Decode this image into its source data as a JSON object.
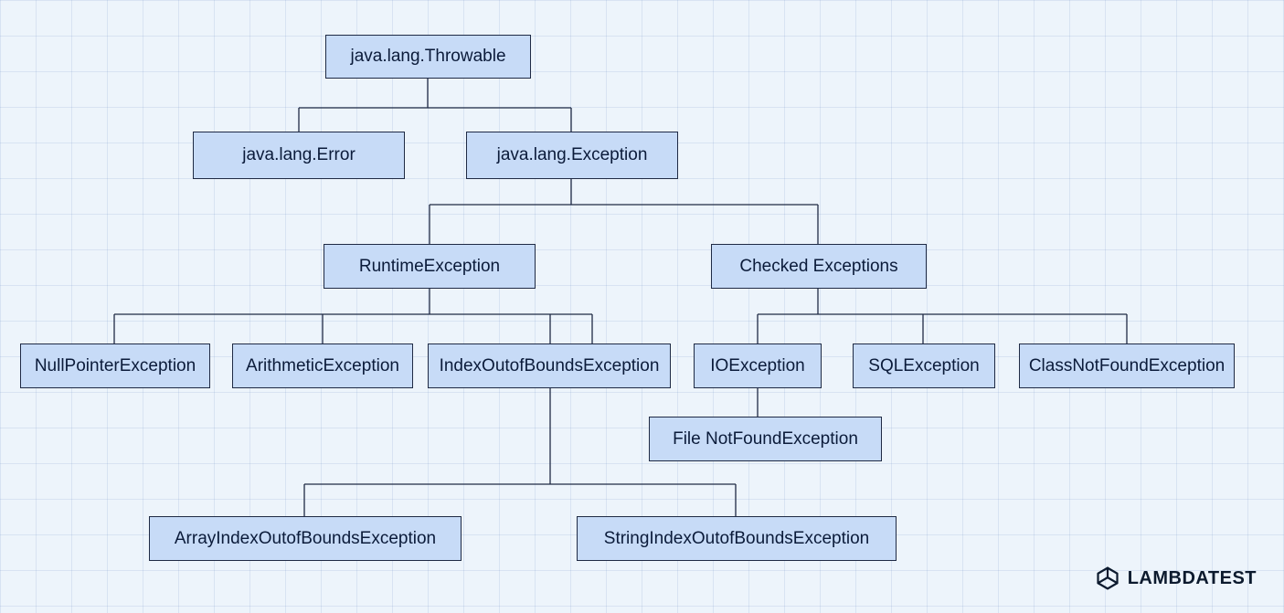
{
  "nodes": {
    "throwable": "java.lang.Throwable",
    "error": "java.lang.Error",
    "exception": "java.lang.Exception",
    "runtime": "RuntimeException",
    "checked": "Checked Exceptions",
    "npe": "NullPointerException",
    "arith": "ArithmeticException",
    "ioob": "IndexOutofBoundsException",
    "io": "IOException",
    "sql": "SQLException",
    "cnfe": "ClassNotFoundException",
    "fnfe": "File NotFoundException",
    "aioob": "ArrayIndexOutofBoundsException",
    "sioob": "StringIndexOutofBoundsException"
  },
  "brand": "LAMBDATEST"
}
